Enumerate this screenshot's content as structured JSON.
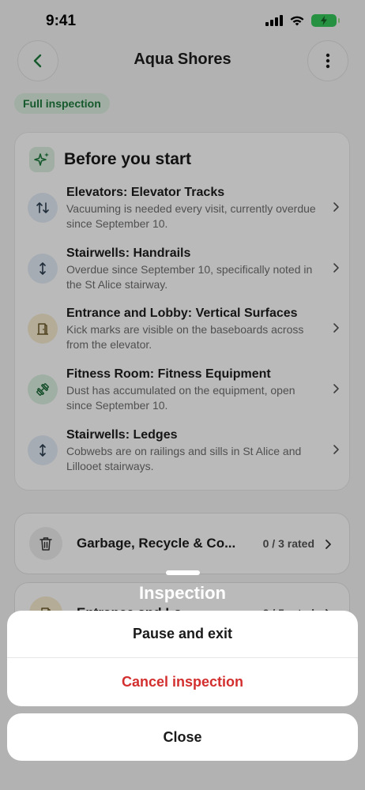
{
  "status_bar": {
    "time": "9:41"
  },
  "header": {
    "title": "Aqua Shores"
  },
  "chip": {
    "label": "Full inspection"
  },
  "before_start": {
    "title": "Before you start",
    "items": [
      {
        "title": "Elevators: Elevator Tracks",
        "desc": "Vacuuming is needed every visit, currently overdue since September 10.",
        "icon": "swap-vertical-icon"
      },
      {
        "title": "Stairwells: Handrails",
        "desc": "Overdue since September 10, specifically noted in the St Alice stairway.",
        "icon": "vertical-arrows-icon"
      },
      {
        "title": "Entrance and Lobby: Vertical Surfaces",
        "desc": "Kick marks are visible on the baseboards across from the elevator.",
        "icon": "door-icon"
      },
      {
        "title": "Fitness Room: Fitness Equipment",
        "desc": "Dust has accumulated on the equipment, open since September 10.",
        "icon": "dumbbell-icon"
      },
      {
        "title": "Stairwells: Ledges",
        "desc": "Cobwebs are on railings and sills in St Alice and Lillooet stairways.",
        "icon": "vertical-arrows-icon"
      }
    ]
  },
  "areas": [
    {
      "title": "Garbage, Recycle & Co...",
      "count": "0 / 3 rated",
      "icon": "trash-icon"
    },
    {
      "title": "Entrance and Lo...",
      "count": "2 / 5 rated",
      "icon": "door-icon"
    }
  ],
  "sheet": {
    "title": "Inspection",
    "pause_label": "Pause and exit",
    "cancel_label": "Cancel inspection",
    "close_label": "Close"
  },
  "colors": {
    "accent_green": "#1f7a3d",
    "danger_red": "#d32f2f",
    "battery_green": "#34c759"
  }
}
